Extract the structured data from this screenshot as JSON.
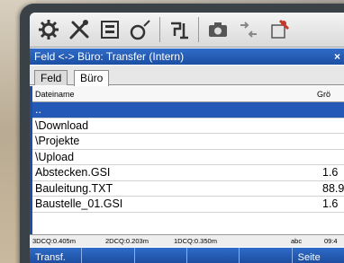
{
  "window": {
    "title": "Feld <-> Büro: Transfer (Intern)",
    "close_glyph": "×"
  },
  "toolbar": {
    "icons": [
      "gear-icon",
      "tools-icon",
      "survey-icon",
      "measure-icon",
      "antenna-icon",
      "camera-icon",
      "transfer-icon",
      "config-icon"
    ]
  },
  "tabs": [
    {
      "label": "Feld",
      "active": false
    },
    {
      "label": "Büro",
      "active": true
    }
  ],
  "list": {
    "columns": {
      "name": "Dateiname",
      "size": "Grö"
    },
    "rows": [
      {
        "name": "..",
        "size": "",
        "selected": true
      },
      {
        "name": "\\Download",
        "size": ""
      },
      {
        "name": "\\Projekte",
        "size": ""
      },
      {
        "name": "\\Upload",
        "size": ""
      },
      {
        "name": "Abstecken.GSI",
        "size": "1.6"
      },
      {
        "name": "Bauleitung.TXT",
        "size": "88.9"
      },
      {
        "name": "Baustelle_01.GSI",
        "size": "1.6"
      }
    ]
  },
  "status": {
    "dcq3": "3DCQ:0.405m",
    "dcq2": "2DCQ:0.203m",
    "dcq1": "1DCQ:0.350m",
    "input_mode": "abc",
    "time": "09:4"
  },
  "softkeys": [
    "Transf.",
    "",
    "",
    "",
    "",
    "Seite"
  ],
  "colors": {
    "accent": "#1c4fa3",
    "selection": "#2459b8"
  }
}
